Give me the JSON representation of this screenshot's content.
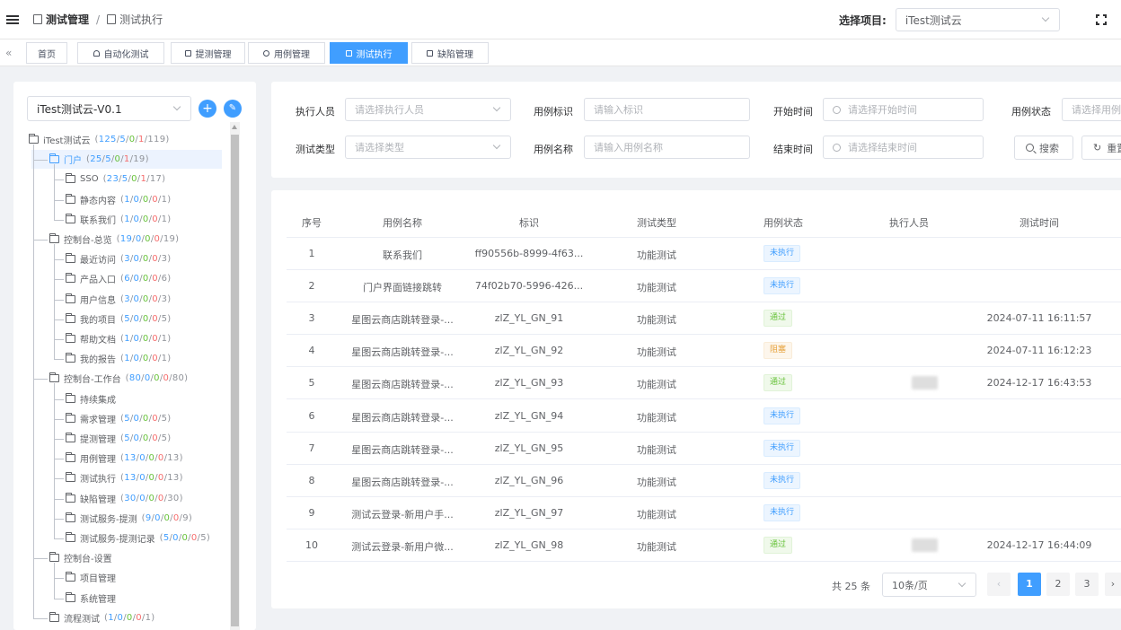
{
  "breadcrumb": {
    "first": "测试管理",
    "separator": "/",
    "last": "测试执行"
  },
  "project": {
    "label": "选择项目:",
    "value": "iTest测试云"
  },
  "tabs": [
    {
      "label": "首页",
      "icon": ""
    },
    {
      "label": "自动化测试",
      "icon": "android-icon"
    },
    {
      "label": "提测管理",
      "icon": "doc-icon"
    },
    {
      "label": "用例管理",
      "icon": "link-icon"
    },
    {
      "label": "测试执行",
      "icon": "card-icon",
      "active": true
    },
    {
      "label": "缺陷管理",
      "icon": "bookmark-icon"
    }
  ],
  "left": {
    "version": "iTest测试云-V0.1",
    "tree": [
      {
        "label": "iTest测试云",
        "counts": [
          "125",
          "5",
          "0",
          "1",
          "119"
        ],
        "level": 0
      },
      {
        "label": "门户",
        "counts": [
          "25",
          "5",
          "0",
          "1",
          "19"
        ],
        "level": 1,
        "selected": true
      },
      {
        "label": "SSO",
        "counts": [
          "23",
          "5",
          "0",
          "1",
          "17"
        ],
        "level": 2
      },
      {
        "label": "静态内容",
        "counts": [
          "1",
          "0",
          "0",
          "0",
          "1"
        ],
        "level": 2
      },
      {
        "label": "联系我们",
        "counts": [
          "1",
          "0",
          "0",
          "0",
          "1"
        ],
        "level": 2
      },
      {
        "label": "控制台-总览",
        "counts": [
          "19",
          "0",
          "0",
          "0",
          "19"
        ],
        "level": 1
      },
      {
        "label": "最近访问",
        "counts": [
          "3",
          "0",
          "0",
          "0",
          "3"
        ],
        "level": 2
      },
      {
        "label": "产品入口",
        "counts": [
          "6",
          "0",
          "0",
          "0",
          "6"
        ],
        "level": 2
      },
      {
        "label": "用户信息",
        "counts": [
          "3",
          "0",
          "0",
          "0",
          "3"
        ],
        "level": 2
      },
      {
        "label": "我的项目",
        "counts": [
          "5",
          "0",
          "0",
          "0",
          "5"
        ],
        "level": 2
      },
      {
        "label": "帮助文档",
        "counts": [
          "1",
          "0",
          "0",
          "0",
          "1"
        ],
        "level": 2
      },
      {
        "label": "我的报告",
        "counts": [
          "1",
          "0",
          "0",
          "0",
          "1"
        ],
        "level": 2
      },
      {
        "label": "控制台-工作台",
        "counts": [
          "80",
          "0",
          "0",
          "0",
          "80"
        ],
        "level": 1
      },
      {
        "label": "持续集成",
        "counts": [],
        "level": 2
      },
      {
        "label": "需求管理",
        "counts": [
          "5",
          "0",
          "0",
          "0",
          "5"
        ],
        "level": 2
      },
      {
        "label": "提测管理",
        "counts": [
          "5",
          "0",
          "0",
          "0",
          "5"
        ],
        "level": 2
      },
      {
        "label": "用例管理",
        "counts": [
          "13",
          "0",
          "0",
          "0",
          "13"
        ],
        "level": 2
      },
      {
        "label": "测试执行",
        "counts": [
          "13",
          "0",
          "0",
          "0",
          "13"
        ],
        "level": 2
      },
      {
        "label": "缺陷管理",
        "counts": [
          "30",
          "0",
          "0",
          "0",
          "30"
        ],
        "level": 2
      },
      {
        "label": "测试服务-提测",
        "counts": [
          "9",
          "0",
          "0",
          "0",
          "9"
        ],
        "level": 2
      },
      {
        "label": "测试服务-提测记录",
        "counts": [
          "5",
          "0",
          "0",
          "0",
          "5"
        ],
        "level": 2
      },
      {
        "label": "控制台-设置",
        "counts": [],
        "level": 1
      },
      {
        "label": "项目管理",
        "counts": [],
        "level": 2
      },
      {
        "label": "系统管理",
        "counts": [],
        "level": 2
      },
      {
        "label": "流程测试",
        "counts": [
          "1",
          "0",
          "0",
          "0",
          "1"
        ],
        "level": 1
      }
    ]
  },
  "filters": {
    "executor": {
      "label": "执行人员",
      "placeholder": "请选择执行人员"
    },
    "case_id": {
      "label": "用例标识",
      "placeholder": "请输入标识"
    },
    "start_time": {
      "label": "开始时间",
      "placeholder": "请选择开始时间"
    },
    "case_status": {
      "label": "用例状态",
      "placeholder": "请选择用例"
    },
    "test_type": {
      "label": "测试类型",
      "placeholder": "请选择类型"
    },
    "case_name": {
      "label": "用例名称",
      "placeholder": "请输入用例名称"
    },
    "end_time": {
      "label": "结束时间",
      "placeholder": "请选择结束时间"
    },
    "search_label": "搜索",
    "reset_label": "重置"
  },
  "table": {
    "headers": [
      "序号",
      "用例名称",
      "标识",
      "测试类型",
      "用例状态",
      "执行人员",
      "测试时间"
    ],
    "rows": [
      {
        "no": "1",
        "name": "联系我们",
        "id": "ff90556b-8999-4f63...",
        "type": "功能测试",
        "status": "未执行",
        "status_kind": "info",
        "executor": false,
        "time": ""
      },
      {
        "no": "2",
        "name": "门户界面链接跳转",
        "id": "74f02b70-5996-426...",
        "type": "功能测试",
        "status": "未执行",
        "status_kind": "info",
        "executor": false,
        "time": ""
      },
      {
        "no": "3",
        "name": "星图云商店跳转登录-...",
        "id": "zlZ_YL_GN_91",
        "type": "功能测试",
        "status": "通过",
        "status_kind": "pass",
        "executor": false,
        "time": "2024-07-11 16:11:57"
      },
      {
        "no": "4",
        "name": "星图云商店跳转登录-...",
        "id": "zlZ_YL_GN_92",
        "type": "功能测试",
        "status": "阻塞",
        "status_kind": "block",
        "executor": false,
        "time": "2024-07-11 16:12:23"
      },
      {
        "no": "5",
        "name": "星图云商店跳转登录-...",
        "id": "zlZ_YL_GN_93",
        "type": "功能测试",
        "status": "通过",
        "status_kind": "pass",
        "executor": true,
        "time": "2024-12-17 16:43:53"
      },
      {
        "no": "6",
        "name": "星图云商店跳转登录-...",
        "id": "zlZ_YL_GN_94",
        "type": "功能测试",
        "status": "未执行",
        "status_kind": "info",
        "executor": false,
        "time": ""
      },
      {
        "no": "7",
        "name": "星图云商店跳转登录-...",
        "id": "zlZ_YL_GN_95",
        "type": "功能测试",
        "status": "未执行",
        "status_kind": "info",
        "executor": false,
        "time": ""
      },
      {
        "no": "8",
        "name": "星图云商店跳转登录-...",
        "id": "zlZ_YL_GN_96",
        "type": "功能测试",
        "status": "未执行",
        "status_kind": "info",
        "executor": false,
        "time": ""
      },
      {
        "no": "9",
        "name": "测试云登录-新用户手...",
        "id": "zlZ_YL_GN_97",
        "type": "功能测试",
        "status": "未执行",
        "status_kind": "info",
        "executor": false,
        "time": ""
      },
      {
        "no": "10",
        "name": "测试云登录-新用户微...",
        "id": "zlZ_YL_GN_98",
        "type": "功能测试",
        "status": "通过",
        "status_kind": "pass",
        "executor": true,
        "time": "2024-12-17 16:44:09"
      }
    ]
  },
  "pagination": {
    "total": "共 25 条",
    "page_size": "10条/页",
    "prev": "‹",
    "pages": [
      "1",
      "2",
      "3"
    ],
    "next": "›",
    "current": "1"
  },
  "colors": {
    "primary": "#409eff",
    "success": "#67c23a",
    "warning": "#e6a23c",
    "danger": "#f56c6c"
  }
}
